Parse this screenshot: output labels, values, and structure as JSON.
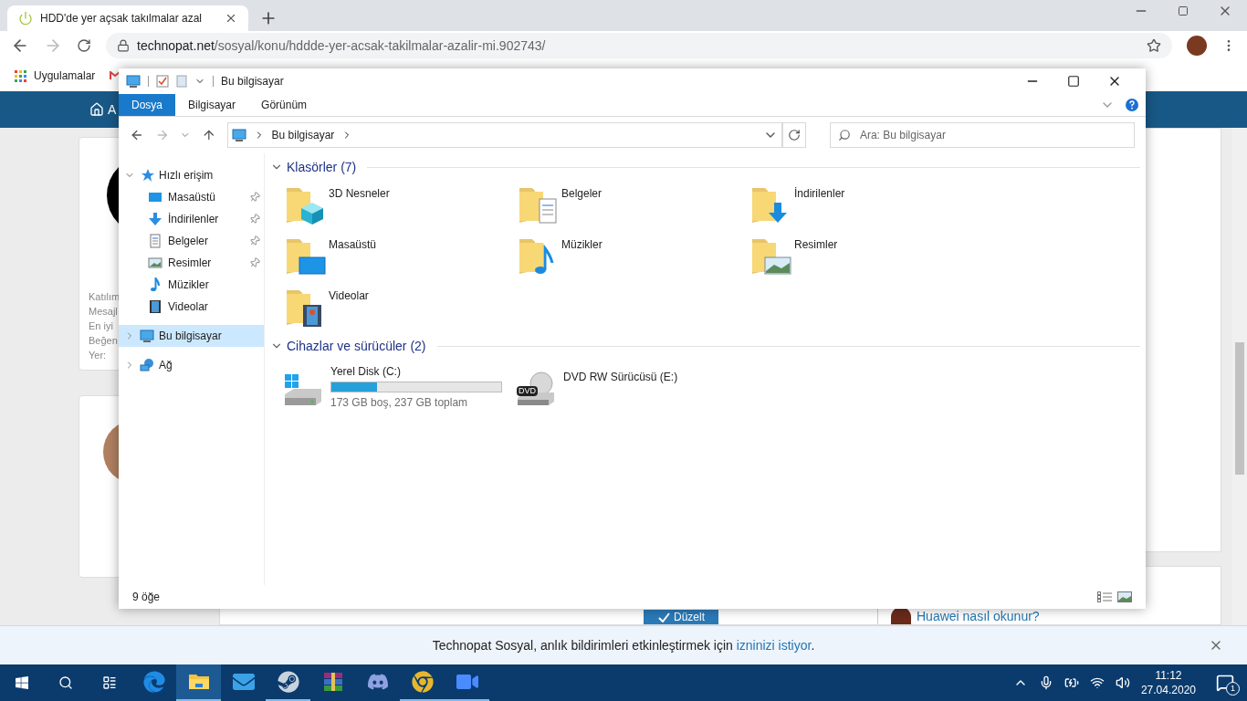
{
  "browser": {
    "tab": {
      "title": "HDD'de yer açsak takılmalar azal",
      "selected": true
    },
    "url": {
      "domain": "technopat.net",
      "path": "/sosyal/konu/hddde-yer-acsak-takilmalar-azalir-mi.902743/"
    },
    "bookmarks": [
      {
        "label": "Uygulamalar"
      }
    ],
    "page": {
      "nav_text": "A",
      "profile_stats": [
        "Katılım",
        "Mesajl",
        "En iyi",
        "Beğen",
        "Yer:"
      ],
      "fix_button": "Düzelt",
      "related_link": "Huawei nasıl okunur?"
    },
    "notification": {
      "text": "Technopat Sosyal, anlık bildirimleri etkinleştirmek için",
      "link": "izninizi istiyor",
      "end": "."
    }
  },
  "explorer": {
    "title": "Bu bilgisayar",
    "ribbon_tabs": [
      {
        "label": "Dosya",
        "selected": true
      },
      {
        "label": "Bilgisayar",
        "selected": false
      },
      {
        "label": "Görünüm",
        "selected": false
      }
    ],
    "breadcrumb": "Bu bilgisayar",
    "search": {
      "placeholder": "Ara: Bu bilgisayar"
    },
    "nav": [
      {
        "label": "Hızlı erişim",
        "kind": "star",
        "expanded": true,
        "selected": false,
        "children": [
          {
            "label": "Masaüstü",
            "kind": "desktop",
            "pinned": true
          },
          {
            "label": "İndirilenler",
            "kind": "downloads",
            "pinned": true
          },
          {
            "label": "Belgeler",
            "kind": "documents",
            "pinned": true
          },
          {
            "label": "Resimler",
            "kind": "pictures",
            "pinned": true
          },
          {
            "label": "Müzikler",
            "kind": "music",
            "pinned": false
          },
          {
            "label": "Videolar",
            "kind": "videos",
            "pinned": false
          }
        ]
      },
      {
        "label": "Bu bilgisayar",
        "kind": "computer",
        "expanded": false,
        "selected": true
      },
      {
        "label": "Ağ",
        "kind": "network",
        "expanded": false,
        "selected": false
      }
    ],
    "sections": [
      {
        "title": "Klasörler (7)",
        "expanded": true,
        "items": [
          {
            "name": "3D Nesneler",
            "kind": "cube"
          },
          {
            "name": "Belgeler",
            "kind": "documents"
          },
          {
            "name": "İndirilenler",
            "kind": "downloads"
          },
          {
            "name": "Masaüstü",
            "kind": "desktop"
          },
          {
            "name": "Müzikler",
            "kind": "music"
          },
          {
            "name": "Resimler",
            "kind": "pictures"
          },
          {
            "name": "Videolar",
            "kind": "videos"
          }
        ]
      },
      {
        "title": "Cihazlar ve sürücüler (2)",
        "expanded": true,
        "items": [
          {
            "name": "Yerel Disk (C:)",
            "kind": "disk",
            "level": 0.27,
            "detail": "173 GB boş, 237 GB toplam"
          },
          {
            "name": "DVD RW Sürücüsü (E:)",
            "kind": "dvd",
            "badge": "DVD"
          }
        ]
      }
    ],
    "status": "9 öğe"
  },
  "taskbar": {
    "apps": [
      {
        "kind": "edge",
        "running": false,
        "selected": false
      },
      {
        "kind": "files",
        "running": true,
        "selected": true
      },
      {
        "kind": "mail",
        "running": false,
        "selected": false
      },
      {
        "kind": "steam",
        "running": true,
        "selected": false
      },
      {
        "kind": "archive",
        "running": false,
        "selected": false
      },
      {
        "kind": "discord",
        "running": false,
        "selected": false
      },
      {
        "kind": "chrome",
        "running": true,
        "selected": false
      },
      {
        "kind": "zoom",
        "running": true,
        "selected": false
      }
    ],
    "time": "11:12",
    "date": "27.04.2020",
    "notification_count": "1"
  }
}
